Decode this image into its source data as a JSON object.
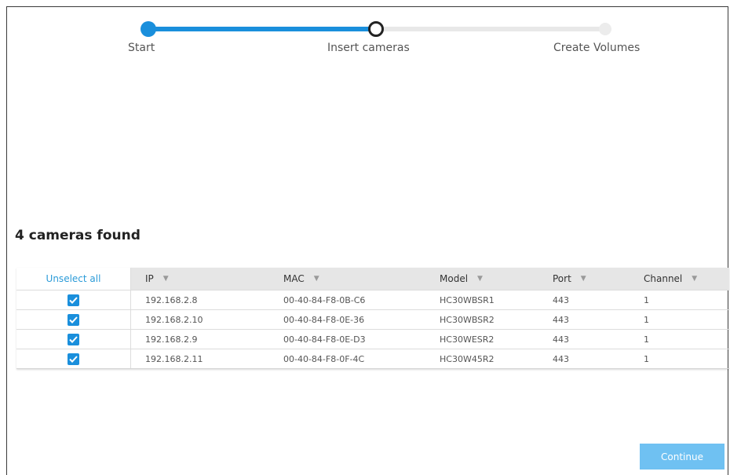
{
  "stepper": {
    "steps": [
      {
        "label": "Start",
        "state": "done"
      },
      {
        "label": "Insert cameras",
        "state": "current"
      },
      {
        "label": "Create Volumes",
        "state": "future"
      }
    ]
  },
  "found_title": "4 cameras found",
  "table": {
    "unselect_label": "Unselect all",
    "columns": [
      "IP",
      "MAC",
      "Model",
      "Port",
      "Channel"
    ],
    "rows": [
      {
        "checked": true,
        "ip": "192.168.2.8",
        "mac": "00-40-84-F8-0B-C6",
        "model": "HC30WBSR1",
        "port": "443",
        "channel": "1"
      },
      {
        "checked": true,
        "ip": "192.168.2.10",
        "mac": "00-40-84-F8-0E-36",
        "model": "HC30WBSR2",
        "port": "443",
        "channel": "1"
      },
      {
        "checked": true,
        "ip": "192.168.2.9",
        "mac": "00-40-84-F8-0E-D3",
        "model": "HC30WESR2",
        "port": "443",
        "channel": "1"
      },
      {
        "checked": true,
        "ip": "192.168.2.11",
        "mac": "00-40-84-F8-0F-4C",
        "model": "HC30W45R2",
        "port": "443",
        "channel": "1"
      }
    ]
  },
  "continue_label": "Continue",
  "colors": {
    "accent": "#1a8fdc",
    "button": "#6fc1f2",
    "link": "#2b9bd8"
  },
  "icons": {
    "sort": "caret-down-icon",
    "checkbox": "checkmark-icon"
  }
}
